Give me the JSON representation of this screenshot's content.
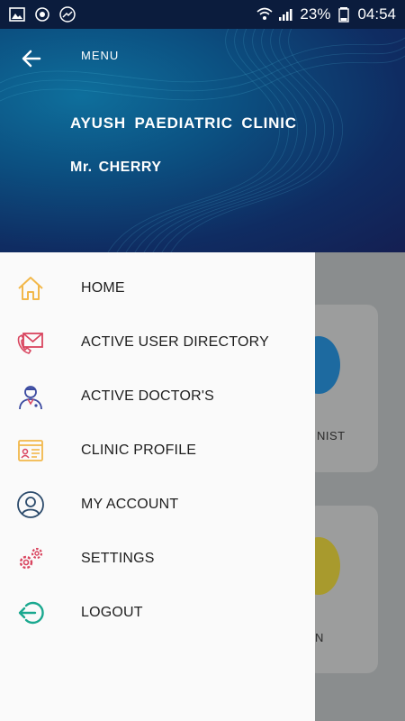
{
  "status_bar": {
    "battery": "23%",
    "time": "04:54",
    "icons": [
      "gallery-icon",
      "sync-icon",
      "trend-icon",
      "wifi-icon",
      "signal-icon",
      "battery-icon"
    ]
  },
  "header": {
    "menu_label": "MENU",
    "clinic_name": "AYUSH PAEDIATRIC CLINIC",
    "user_name": "Mr. CHERRY",
    "back_icon": "arrow-left-icon"
  },
  "menu": {
    "items": [
      {
        "label": "HOME",
        "icon": "home-icon",
        "color": "#f2b84b"
      },
      {
        "label": "ACTIVE USER DIRECTORY",
        "icon": "mail-phone-icon",
        "color": "#d9455f"
      },
      {
        "label": "ACTIVE DOCTOR'S",
        "icon": "doctor-icon",
        "color": "#3b4aa0"
      },
      {
        "label": "CLINIC PROFILE",
        "icon": "profile-card-icon",
        "color": "#f2b84b"
      },
      {
        "label": "MY ACCOUNT",
        "icon": "account-icon",
        "color": "#2b4a6b"
      },
      {
        "label": "SETTINGS",
        "icon": "gears-icon",
        "color": "#d9455f"
      },
      {
        "label": "LOGOUT",
        "icon": "logout-icon",
        "color": "#1aa88f"
      }
    ]
  },
  "background": {
    "card1_text": "NIST",
    "card2_text": "N"
  }
}
